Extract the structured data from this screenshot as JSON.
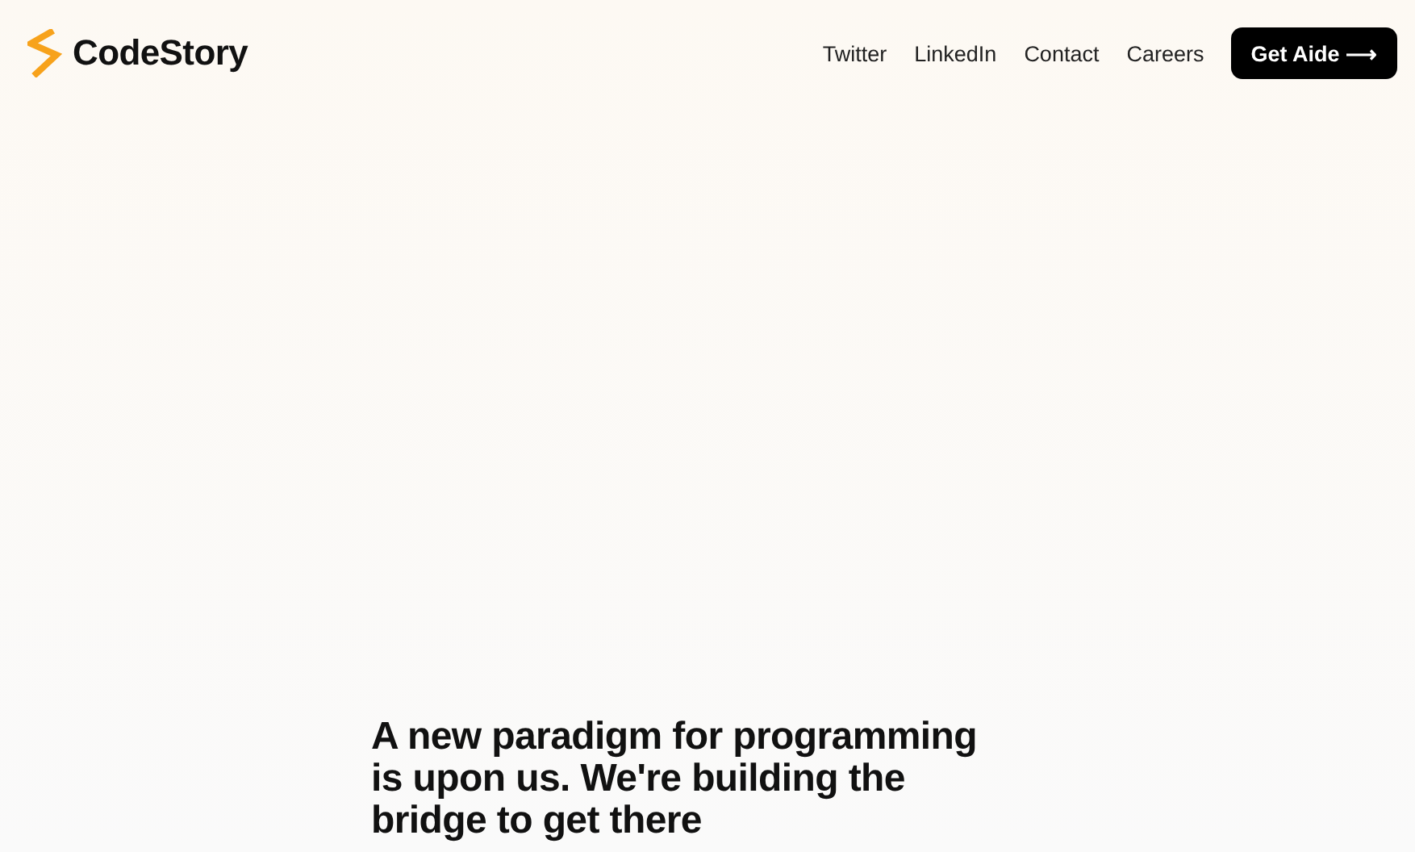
{
  "header": {
    "logo": "CodeStory",
    "nav": [
      "Twitter",
      "LinkedIn",
      "Contact",
      "Careers"
    ],
    "cta": "Get Aide ⟶"
  },
  "hero": {
    "headline": "A new paradigm for programming is upon us. We're building the bridge to get there"
  }
}
